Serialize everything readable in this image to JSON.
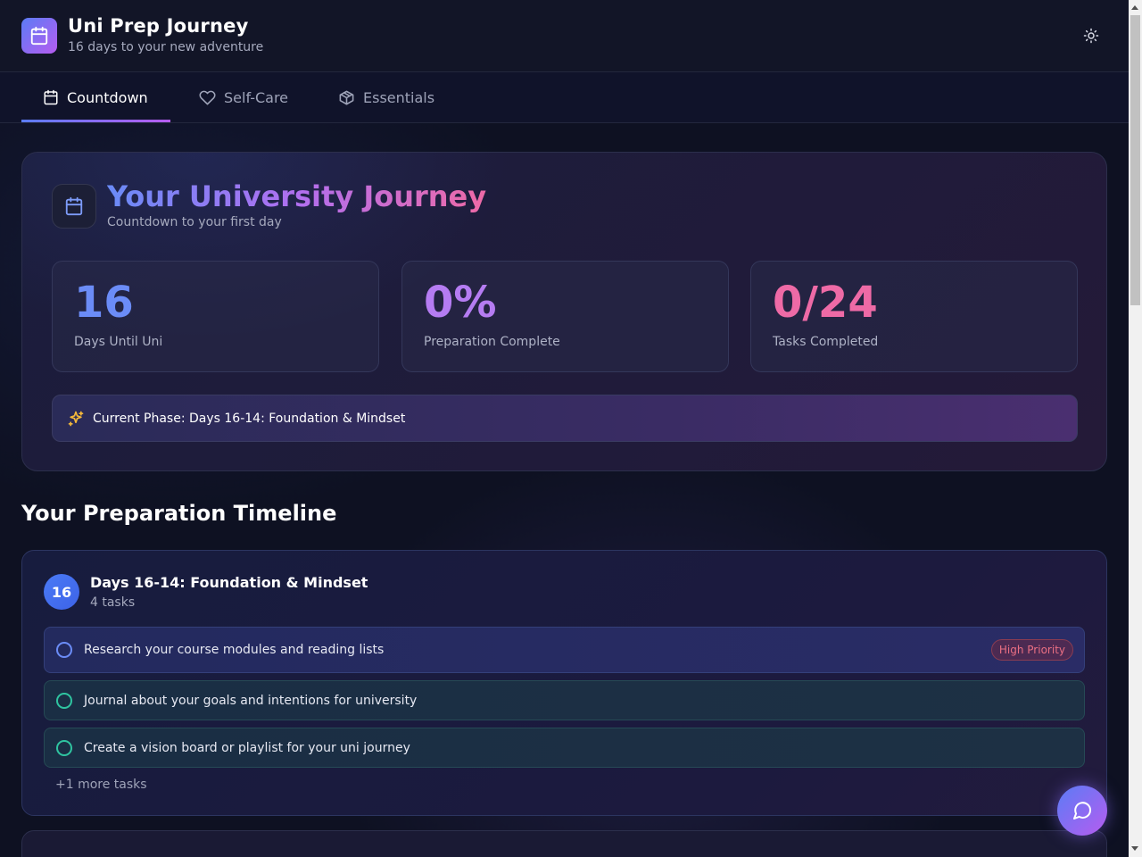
{
  "app": {
    "title": "Uni Prep Journey",
    "subtitle": "16 days to your new adventure"
  },
  "tabs": [
    {
      "label": "Countdown",
      "icon": "calendar-icon",
      "active": true
    },
    {
      "label": "Self-Care",
      "icon": "heart-icon",
      "active": false
    },
    {
      "label": "Essentials",
      "icon": "package-icon",
      "active": false
    }
  ],
  "hero": {
    "title": "Your University Journey",
    "subtitle": "Countdown to your first day",
    "stats": [
      {
        "value": "16",
        "label": "Days Until Uni",
        "color": "#6b8cf7"
      },
      {
        "value": "0%",
        "label": "Preparation Complete",
        "color": "#b57cf2"
      },
      {
        "value": "0/24",
        "label": "Tasks Completed",
        "color": "#ee6aa6"
      }
    ],
    "phase_banner": "Current Phase: Days 16-14: Foundation & Mindset"
  },
  "timeline": {
    "title": "Your Preparation Timeline",
    "phases": [
      {
        "number": "16",
        "title": "Days 16-14: Foundation & Mindset",
        "count": "4 tasks",
        "tasks": [
          {
            "text": "Research your course modules and reading lists",
            "badge": "High Priority"
          },
          {
            "text": "Journal about your goals and intentions for university"
          },
          {
            "text": "Create a vision board or playlist for your uni journey"
          }
        ],
        "more": "+1 more tasks"
      }
    ]
  },
  "colors": {
    "accent_blue": "#5b7cf5",
    "accent_purple": "#b65cf0",
    "accent_pink": "#ee6aa6",
    "teal": "#2fc4a0"
  }
}
